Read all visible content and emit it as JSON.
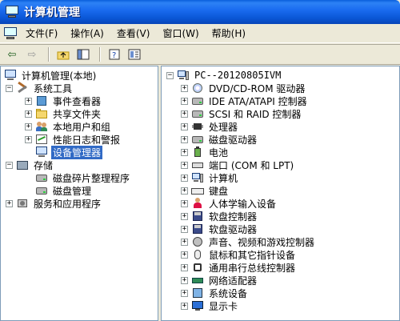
{
  "window": {
    "title": "计算机管理"
  },
  "menu": {
    "items": [
      "文件(F)",
      "操作(A)",
      "查看(V)",
      "窗口(W)",
      "帮助(H)"
    ]
  },
  "toolbar": {
    "buttons": [
      "back-arrow-icon",
      "forward-arrow-icon",
      "up-folder-icon",
      "show-hide-tree-icon",
      "help-icon",
      "properties-icon"
    ]
  },
  "left_tree": {
    "items": [
      {
        "label": "计算机管理(本地)",
        "expander": ""
      },
      {
        "label": "系统工具",
        "expander": "−"
      },
      {
        "label": "事件查看器",
        "expander": "+"
      },
      {
        "label": "共享文件夹",
        "expander": "+"
      },
      {
        "label": "本地用户和组",
        "expander": "+"
      },
      {
        "label": "性能日志和警报",
        "expander": "+"
      },
      {
        "label": "设备管理器",
        "expander": "",
        "selected": true
      },
      {
        "label": "存储",
        "expander": "−"
      },
      {
        "label": "磁盘碎片整理程序",
        "expander": ""
      },
      {
        "label": "磁盘管理",
        "expander": ""
      },
      {
        "label": "服务和应用程序",
        "expander": "+"
      }
    ]
  },
  "right_tree": {
    "root": "PC--20120805IVM",
    "root_expander": "−",
    "items": [
      {
        "label": "DVD/CD-ROM 驱动器",
        "expander": "+"
      },
      {
        "label": "IDE ATA/ATAPI 控制器",
        "expander": "+"
      },
      {
        "label": "SCSI 和 RAID 控制器",
        "expander": "+"
      },
      {
        "label": "处理器",
        "expander": "+"
      },
      {
        "label": "磁盘驱动器",
        "expander": "+"
      },
      {
        "label": "电池",
        "expander": "+"
      },
      {
        "label": "端口 (COM 和 LPT)",
        "expander": "+"
      },
      {
        "label": "计算机",
        "expander": "+"
      },
      {
        "label": "键盘",
        "expander": "+"
      },
      {
        "label": "人体学输入设备",
        "expander": "+"
      },
      {
        "label": "软盘控制器",
        "expander": "+"
      },
      {
        "label": "软盘驱动器",
        "expander": "+"
      },
      {
        "label": "声音、视频和游戏控制器",
        "expander": "+"
      },
      {
        "label": "鼠标和其它指针设备",
        "expander": "+"
      },
      {
        "label": "通用串行总线控制器",
        "expander": "+"
      },
      {
        "label": "网络适配器",
        "expander": "+"
      },
      {
        "label": "系统设备",
        "expander": "+"
      },
      {
        "label": "显示卡",
        "expander": "+"
      }
    ]
  },
  "colors": {
    "titlebar": "#0a57d6",
    "selection": "#316ac5",
    "chrome": "#ece9d8"
  }
}
